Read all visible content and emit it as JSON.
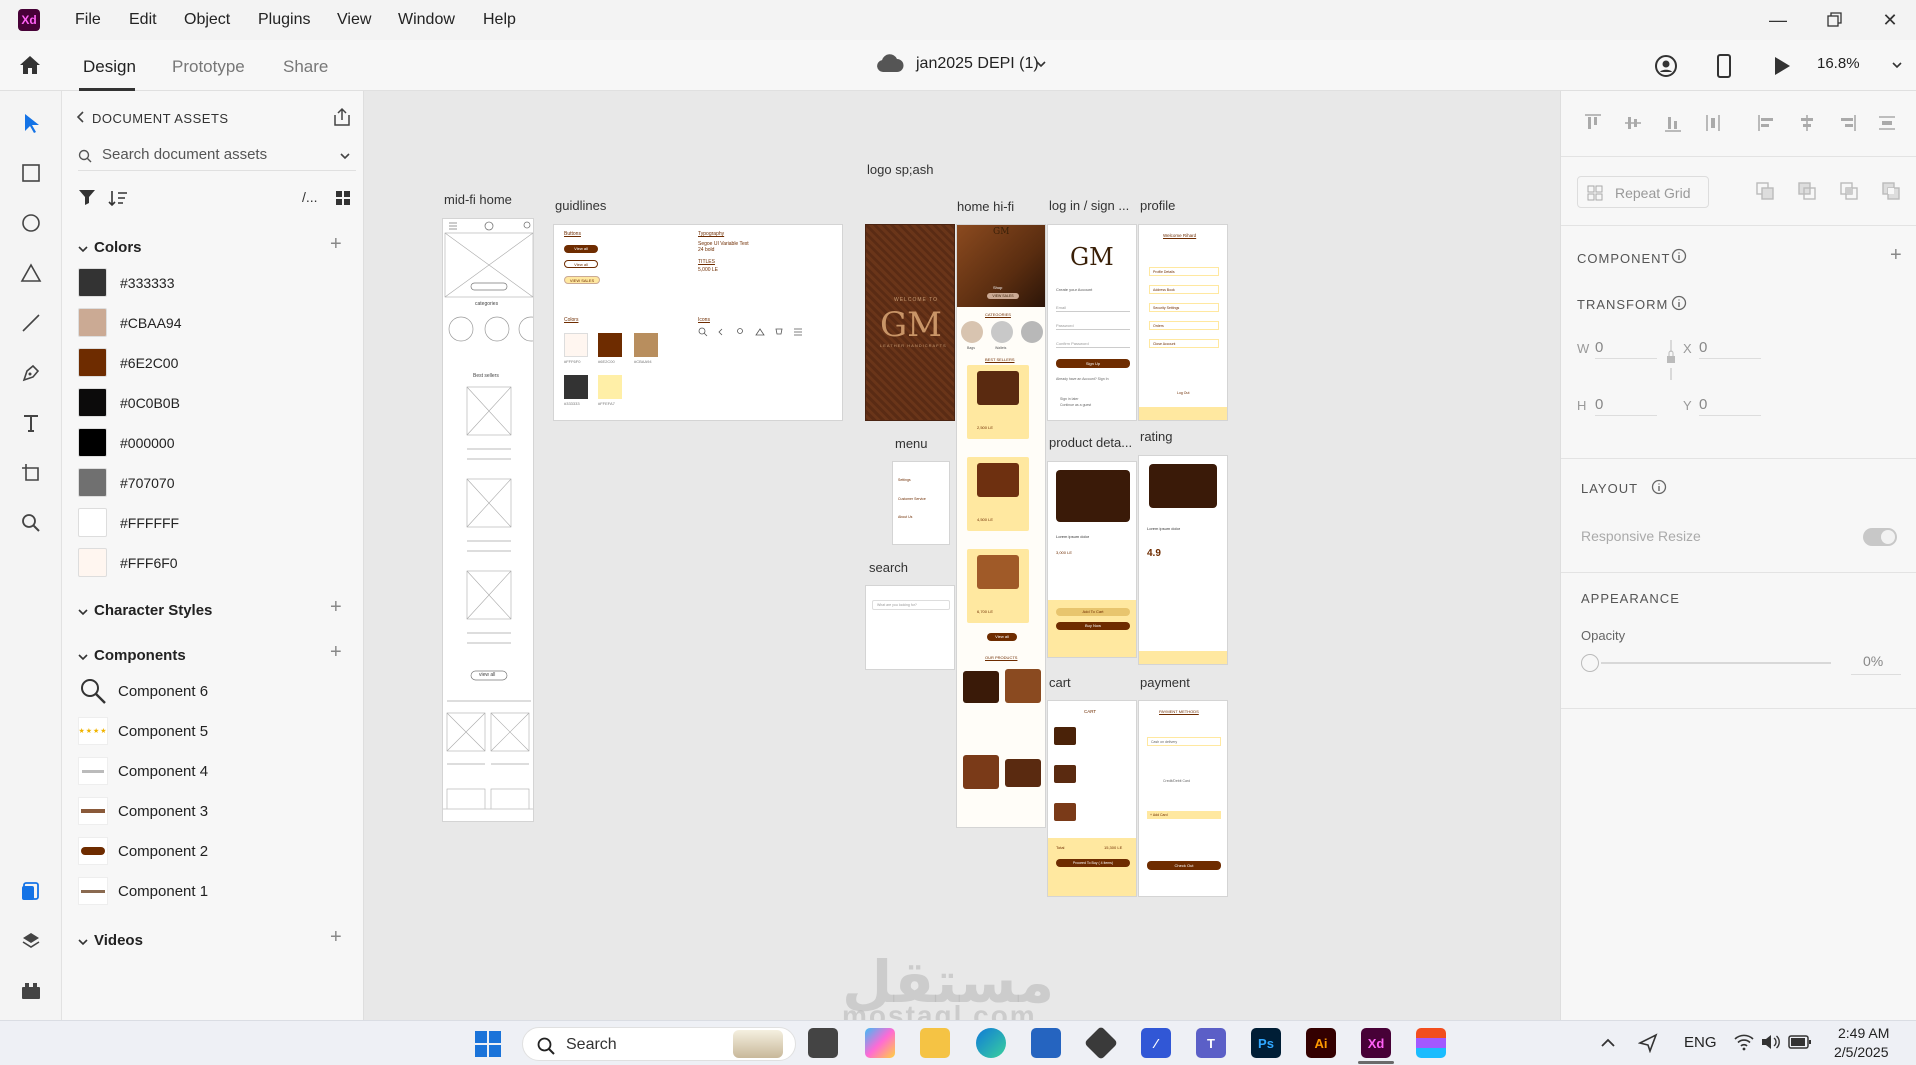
{
  "app": {
    "name": "Xd",
    "menus": [
      "File",
      "Edit",
      "Object",
      "Plugins",
      "View",
      "Window",
      "Help"
    ]
  },
  "toolbar": {
    "tabs": [
      "Design",
      "Prototype",
      "Share"
    ],
    "active_tab": "Design",
    "document_title": "jan2025 DEPI (1)",
    "zoom": "16.8%"
  },
  "assets": {
    "title": "DOCUMENT ASSETS",
    "search_placeholder": "Search document assets",
    "view_toggle": "/...",
    "colors_title": "Colors",
    "colors": [
      {
        "label": "#333333",
        "hex": "#333333"
      },
      {
        "label": "#CBAA94",
        "hex": "#CBAA94"
      },
      {
        "label": "#6E2C00",
        "hex": "#6E2C00"
      },
      {
        "label": "#0C0B0B",
        "hex": "#0C0B0B"
      },
      {
        "label": "#000000",
        "hex": "#000000"
      },
      {
        "label": "#707070",
        "hex": "#707070"
      },
      {
        "label": "#FFFFFF",
        "hex": "#FFFFFF"
      },
      {
        "label": "#FFF6F0",
        "hex": "#FFF6F0"
      }
    ],
    "char_styles_title": "Character Styles",
    "components_title": "Components",
    "components": [
      "Component 6",
      "Component 5",
      "Component 4",
      "Component 3",
      "Component 2",
      "Component 1"
    ],
    "videos_title": "Videos"
  },
  "canvas": {
    "artboards": {
      "midfi_home": "mid-fi home",
      "guidelines": "guidlines",
      "logo_splash": "logo sp;ash",
      "home_hifi": "home hi-fi",
      "login": "log in / sign ...",
      "profile": "profile",
      "menu": "menu",
      "search": "search",
      "product_details": "product deta...",
      "rating": "rating",
      "cart": "cart",
      "payment": "payment"
    },
    "content": {
      "logo_text": "GM",
      "welcome_to": "WELCOME TO",
      "leather_tag": "LEATHER HANDICRAFTS",
      "midfi_categories": "categories",
      "midfi_best": "Best sellers",
      "midfi_viewall": "view all",
      "guide_buttons": "Buttons",
      "guide_typography": "Typography",
      "guide_font": "Segoe UI Variable Text",
      "guide_font_size": "24 bold",
      "guide_titles": "TITLES",
      "guide_price": "5,000 LE",
      "guide_colors": "Colors",
      "guide_icons": "Icons",
      "guide_view_all": "View all",
      "guide_view_all2": "View all",
      "guide_view_sales": "VIEW SALES",
      "guide_swatches": [
        "#FFF6F0",
        "#6E2C00",
        "#CBAA94",
        "#333333",
        "#FFEFA7"
      ],
      "hifi_categories": "CATEGORIES",
      "hifi_best": "BEST SELLERS",
      "hifi_products": "OUR PRODUCTS",
      "hifi_view_all": "View all",
      "hifi_shop": "Shop",
      "hifi_see_sales": "VIEW SALES",
      "hifi_cats": [
        "Bags",
        "Wallets",
        ""
      ],
      "hifi_prices": [
        "2,500 LE",
        "4,500 LE",
        "6,700 LE"
      ],
      "login_create": "Create your Account",
      "login_email": "Email",
      "login_password": "Password",
      "login_confirm": "Confirm Password",
      "login_signup": "Sign Up",
      "login_already": "Already have an Account? Sign In",
      "login_guest": "Continue as a guest",
      "login_sign_later": "Sign in later",
      "profile_welcome": "Welcome Rihard",
      "profile_items": [
        "Profile Details",
        "Address Book",
        "Security Settings",
        "Orders",
        "Close Account"
      ],
      "profile_logout": "Log Out",
      "menu_items": [
        "Settings",
        "Customer Service",
        "About Us"
      ],
      "search_placeholder": "What are you looking for?",
      "product_title": "Lorem ipsum dolor",
      "product_price": "3,000 LE",
      "product_add": "Add To Cart",
      "product_buy": "Buy Now",
      "rating_value": "4.9",
      "rating_title": "Lorem ipsum dolor",
      "cart_title": "CART",
      "cart_total_label": "Total",
      "cart_total_value": "15,300 LE",
      "cart_proceed": "Proceed To Buy ( 4 items)",
      "payment_title": "PAYMENT METHODS",
      "payment_cash": "Cash on delivery",
      "payment_card": "Credit/Debit Card",
      "payment_add": "+ Add Card",
      "payment_checkout": "Check Out"
    }
  },
  "props": {
    "repeat_grid": "Repeat Grid",
    "component": "COMPONENT",
    "transform": "TRANSFORM",
    "w_label": "W",
    "w_value": "0",
    "x_label": "X",
    "x_value": "0",
    "h_label": "H",
    "h_value": "0",
    "y_label": "Y",
    "y_value": "0",
    "layout": "LAYOUT",
    "responsive_resize": "Responsive Resize",
    "appearance": "APPEARANCE",
    "opacity_label": "Opacity",
    "opacity_value": "0%"
  },
  "taskbar": {
    "search": "Search",
    "lang": "ENG",
    "time": "2:49 AM",
    "date": "2/5/2025"
  },
  "watermark": {
    "arabic": "مستقل",
    "latin": "mostaql.com"
  }
}
